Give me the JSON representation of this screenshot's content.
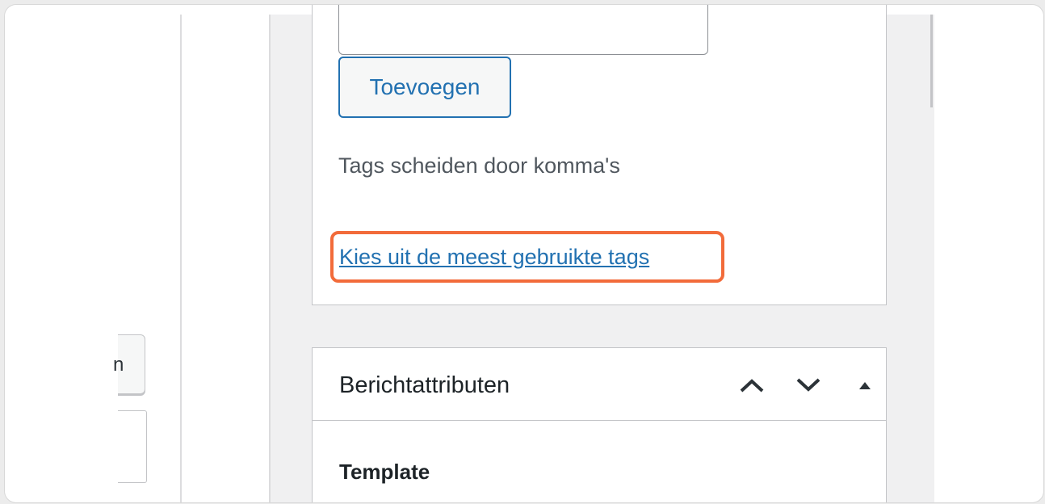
{
  "left_panel": {
    "partial_button_label": "n"
  },
  "tags_box": {
    "add_button_label": "Toevoegen",
    "help_text": "Tags scheiden door komma's",
    "most_used_link": "Kies uit de meest gebruikte tags"
  },
  "post_attributes": {
    "title": "Berichtattributen",
    "move_up_icon": "chevron-up-icon",
    "move_down_icon": "chevron-down-icon",
    "toggle_icon": "triangle-up-icon",
    "template_label": "Template"
  },
  "colors": {
    "link": "#2271b1",
    "highlight": "#f26b3a",
    "panel_border": "#c3c4c7",
    "sidebar_bg": "#f0f0f1"
  }
}
